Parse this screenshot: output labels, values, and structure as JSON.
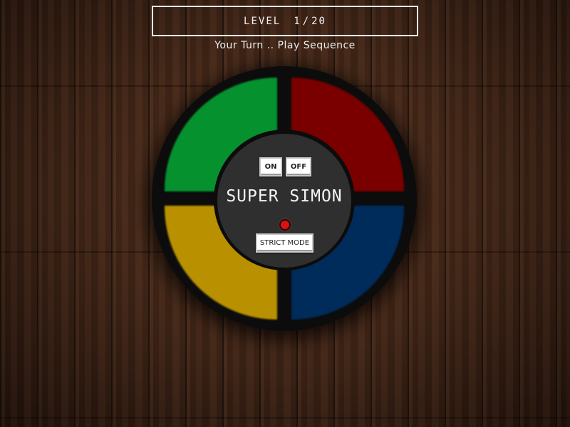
{
  "header": {
    "level_label": "LEVEL",
    "level_current": "1",
    "level_separator": "/",
    "level_total": "20"
  },
  "status": {
    "message": "Your Turn .. Play Sequence"
  },
  "game": {
    "title": "SUPER SIMON",
    "power_on_label": "ON",
    "power_off_label": "OFF",
    "strict_label": "STRICT MODE",
    "strict_indicator_active": true
  },
  "pads": [
    {
      "name": "green",
      "color": "#06912f"
    },
    {
      "name": "red",
      "color": "#7a0000"
    },
    {
      "name": "yellow",
      "color": "#b89000"
    },
    {
      "name": "blue",
      "color": "#002c5c"
    }
  ],
  "colors": {
    "board": "#0c0c0c",
    "center_face": "#2f2f2f",
    "led": "#e01010",
    "text": "#f2f2f2"
  }
}
